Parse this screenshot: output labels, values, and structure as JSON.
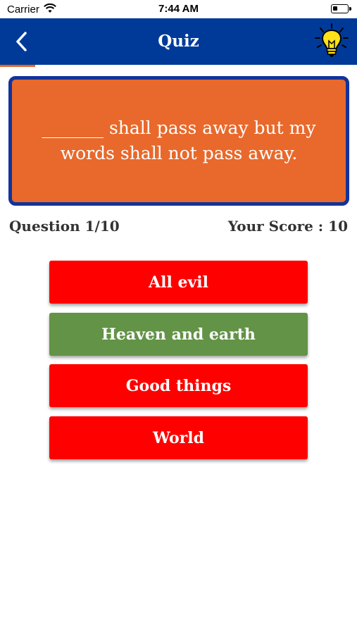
{
  "status_bar": {
    "carrier": "Carrier",
    "time": "7:44 AM"
  },
  "nav": {
    "title": "Quiz",
    "back_icon": "chevron-left-icon",
    "hint_icon": "lightbulb-icon"
  },
  "question": {
    "text": "_______ shall pass away  but my words shall not pass away.",
    "counter": "Question 1/10",
    "score": "Your Score : 10"
  },
  "answers": [
    {
      "label": "All evil",
      "state": "incorrect"
    },
    {
      "label": "Heaven and earth",
      "state": "correct"
    },
    {
      "label": "Good things",
      "state": "incorrect"
    },
    {
      "label": "World",
      "state": "incorrect"
    }
  ],
  "colors": {
    "nav_bg": "#003a99",
    "card_bg": "#e8692b",
    "card_border": "#13339a",
    "incorrect": "#fe0000",
    "correct": "#629346"
  }
}
